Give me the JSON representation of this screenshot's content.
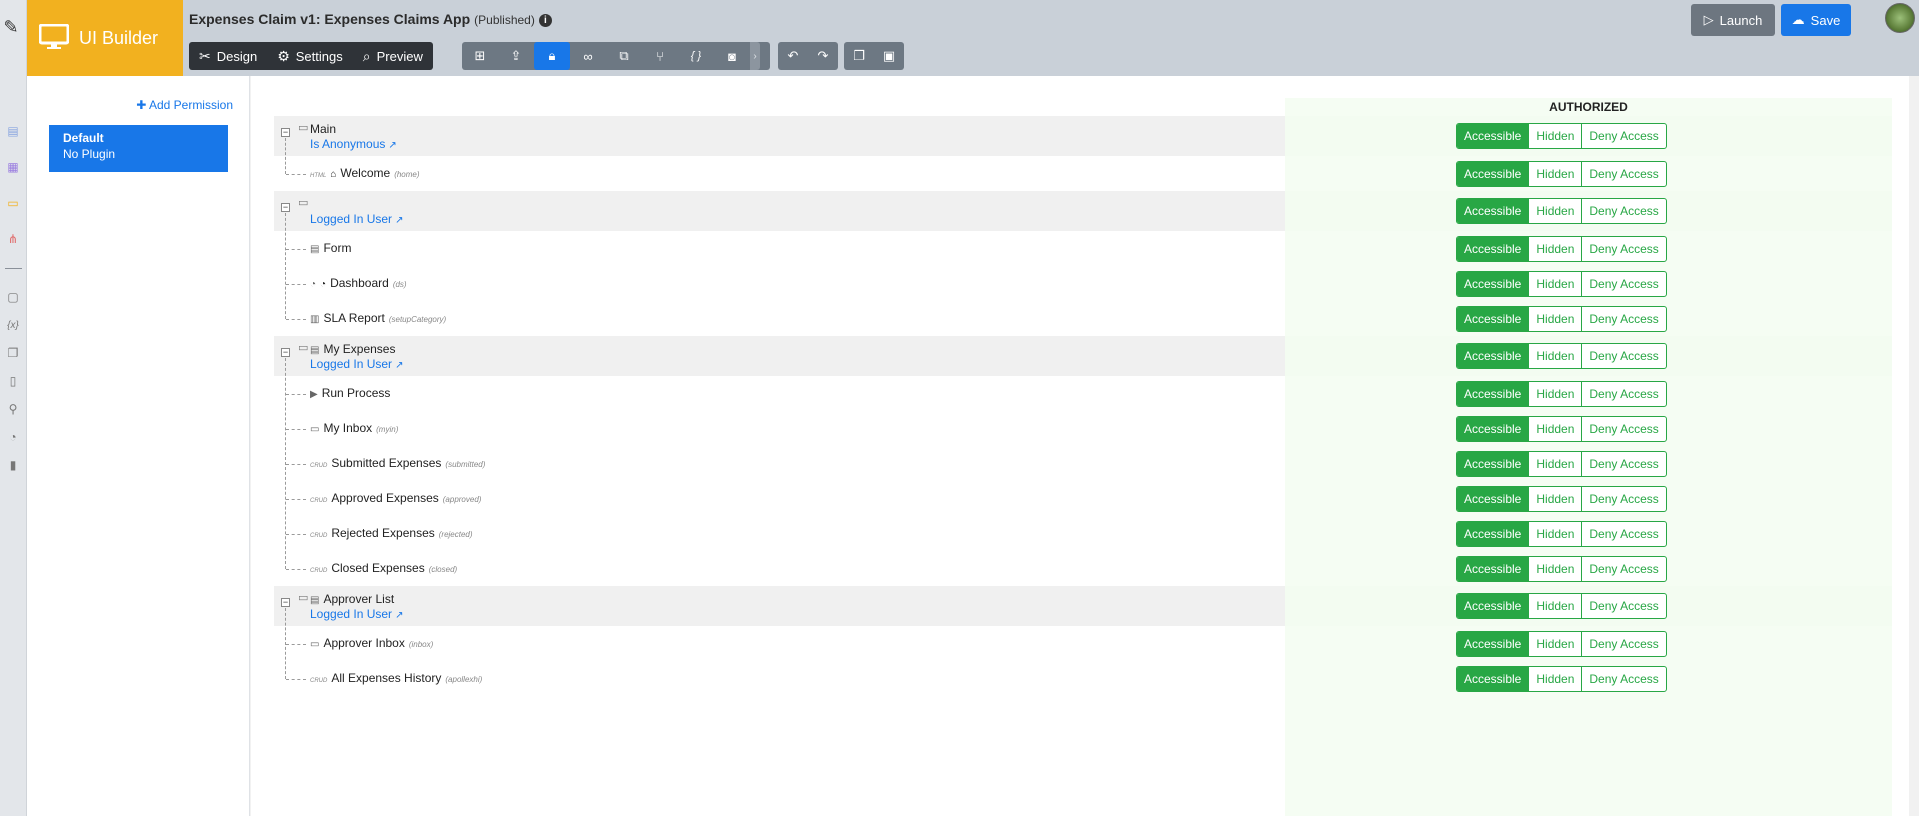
{
  "header": {
    "brand_title": "UI Builder",
    "app_title": "Expenses Claim v1: Expenses Claims App",
    "status": "(Published)",
    "modes": [
      {
        "label": "Design",
        "icon": "design-icon"
      },
      {
        "label": "Settings",
        "icon": "gear-icon"
      },
      {
        "label": "Preview",
        "icon": "preview-icon"
      }
    ],
    "launch_label": "Launch",
    "save_label": "Save"
  },
  "toolbar": {
    "tools": [
      "sitemap-icon",
      "export-icon",
      "lock-icon",
      "binoculars-icon",
      "translate-icon",
      "branch-icon",
      "braces-icon",
      "camera-icon"
    ],
    "active_tool": "lock-icon",
    "braces_text": "{ }"
  },
  "permissions_panel": {
    "add_label": "Add Permission",
    "items": [
      {
        "name": "Default",
        "plugin": "No Plugin"
      }
    ]
  },
  "column_header": "AUTHORIZED",
  "permission_options": [
    "Accessible",
    "Hidden",
    "Deny Access"
  ],
  "selected_option": "Accessible",
  "rows": [
    {
      "type": "menu",
      "label": "Main",
      "permission": "Is Anonymous"
    },
    {
      "type": "item",
      "label": "Welcome",
      "key": "(home)",
      "type_icon": "HTML"
    },
    {
      "type": "menu",
      "label": "",
      "permission": "Logged In User"
    },
    {
      "type": "item",
      "label": "Form",
      "key": "",
      "type_icon": "form-icon"
    },
    {
      "type": "item",
      "label": "Dashboard",
      "key": "(ds)",
      "type_icon": "dashboard-icon"
    },
    {
      "type": "item",
      "label": "SLA Report",
      "key": "(setupCategory)",
      "type_icon": "report-icon"
    },
    {
      "type": "menu",
      "label": "My Expenses",
      "permission": "Logged In User"
    },
    {
      "type": "item",
      "label": "Run Process",
      "key": "",
      "type_icon": "play-icon"
    },
    {
      "type": "item",
      "label": "My Inbox",
      "key": "(myin)",
      "type_icon": "inbox-icon"
    },
    {
      "type": "item",
      "label": "Submitted Expenses",
      "key": "(submitted)",
      "type_icon": "CRUD"
    },
    {
      "type": "item",
      "label": "Approved Expenses",
      "key": "(approved)",
      "type_icon": "CRUD"
    },
    {
      "type": "item",
      "label": "Rejected Expenses",
      "key": "(rejected)",
      "type_icon": "CRUD"
    },
    {
      "type": "item",
      "label": "Closed Expenses",
      "key": "(closed)",
      "type_icon": "CRUD"
    },
    {
      "type": "menu",
      "label": "Approver List",
      "permission": "Logged In User"
    },
    {
      "type": "item",
      "label": "Approver Inbox",
      "key": "(inbox)",
      "type_icon": "inbox-icon"
    },
    {
      "type": "item",
      "label": "All Expenses History",
      "key": "(apollexhi)",
      "type_icon": "CRUD"
    }
  ],
  "colors": {
    "brand": "#f2b11f",
    "primary": "#1877e8",
    "success": "#28a745"
  }
}
